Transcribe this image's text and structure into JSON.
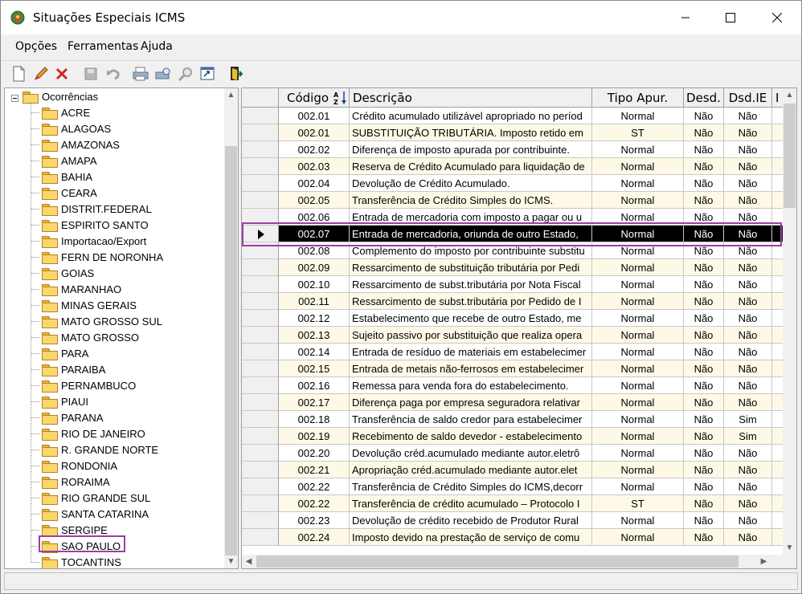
{
  "window": {
    "title": "Situações Especiais ICMS"
  },
  "menu": {
    "opcoes": "Opções",
    "ferramentas": "Ferramentas",
    "ajuda": "Ajuda"
  },
  "toolbar": {
    "icons": [
      "new-document-icon",
      "edit-pencil-icon",
      "delete-x-icon",
      "save-disk-icon",
      "undo-icon",
      "print-icon",
      "print-preview-icon",
      "search-icon",
      "export-icon",
      "exit-door-icon"
    ]
  },
  "tree": {
    "root": "Ocorrências",
    "items": [
      "ACRE",
      "ALAGOAS",
      "AMAZONAS",
      "AMAPA",
      "BAHIA",
      "CEARA",
      "DISTRIT.FEDERAL",
      "ESPIRITO SANTO",
      "Importacao/Export",
      "FERN DE NORONHA",
      "GOIAS",
      "MARANHAO",
      "MINAS GERAIS",
      "MATO GROSSO SUL",
      "MATO GROSSO",
      "PARA",
      "PARAIBA",
      "PERNAMBUCO",
      "PIAUI",
      "PARANA",
      "RIO DE JANEIRO",
      "R. GRANDE NORTE",
      "RONDONIA",
      "RORAIMA",
      "RIO GRANDE SUL",
      "SANTA CATARINA",
      "SERGIPE",
      "SAO PAULO",
      "TOCANTINS"
    ],
    "selected": "SAO PAULO"
  },
  "grid": {
    "headers": {
      "codigo": "Código",
      "sort_icon": "sort-az-icon",
      "descricao": "Descrição",
      "tipo": "Tipo Apur.",
      "desd": "Desd.",
      "dsdie": "Dsd.IE",
      "last": "I"
    },
    "rows": [
      [
        "002.01",
        "Crédito acumulado utilizável apropriado no períod",
        "Normal",
        "Não",
        "Não"
      ],
      [
        "002.01",
        "SUBSTITUIÇÃO TRIBUTÁRIA. Imposto retido em",
        "ST",
        "Não",
        "Não"
      ],
      [
        "002.02",
        "Diferença de imposto apurada por contribuinte.",
        "Normal",
        "Não",
        "Não"
      ],
      [
        "002.03",
        "Reserva de Crédito Acumulado para liquidação de",
        "Normal",
        "Não",
        "Não"
      ],
      [
        "002.04",
        "Devolução de Crédito Acumulado.",
        "Normal",
        "Não",
        "Não"
      ],
      [
        "002.05",
        "Transferência de Crédito Simples do ICMS.",
        "Normal",
        "Não",
        "Não"
      ],
      [
        "002.06",
        "Entrada de mercadoria com imposto a pagar ou u",
        "Normal",
        "Não",
        "Não"
      ],
      [
        "002.07",
        "Entrada de mercadoria, oriunda de outro Estado,",
        "Normal",
        "Não",
        "Não"
      ],
      [
        "002.08",
        "Complemento do imposto por contribuinte substitu",
        "Normal",
        "Não",
        "Não"
      ],
      [
        "002.09",
        "Ressarcimento de substituição tributária por Pedi",
        "Normal",
        "Não",
        "Não"
      ],
      [
        "002.10",
        "Ressarcimento de subst.tributária por Nota Fiscal",
        "Normal",
        "Não",
        "Não"
      ],
      [
        "002.11",
        "Ressarcimento de subst.tributária por Pedido de I",
        "Normal",
        "Não",
        "Não"
      ],
      [
        "002.12",
        "Estabelecimento que recebe de outro Estado, me",
        "Normal",
        "Não",
        "Não"
      ],
      [
        "002.13",
        "Sujeito passivo por substituição que realiza opera",
        "Normal",
        "Não",
        "Não"
      ],
      [
        "002.14",
        "Entrada de resíduo de materiais em estabelecimer",
        "Normal",
        "Não",
        "Não"
      ],
      [
        "002.15",
        "Entrada de metais não-ferrosos em estabelecimer",
        "Normal",
        "Não",
        "Não"
      ],
      [
        "002.16",
        "Remessa para venda fora do estabelecimento.",
        "Normal",
        "Não",
        "Não"
      ],
      [
        "002.17",
        "Diferença paga por empresa seguradora relativar",
        "Normal",
        "Não",
        "Não"
      ],
      [
        "002.18",
        "Transferência de saldo credor para estabelecimer",
        "Normal",
        "Não",
        "Sim"
      ],
      [
        "002.19",
        "Recebimento de saldo devedor - estabelecimento",
        "Normal",
        "Não",
        "Sim"
      ],
      [
        "002.20",
        "Devolução créd.acumulado mediante autor.eletrô",
        "Normal",
        "Não",
        "Não"
      ],
      [
        "002.21",
        "Apropriação créd.acumulado mediante autor.elet",
        "Normal",
        "Não",
        "Não"
      ],
      [
        "002.22",
        "Transferência de Crédito Simples do ICMS,decorr",
        "Normal",
        "Não",
        "Não"
      ],
      [
        "002.22",
        "Transferência de crédito acumulado – Protocolo I",
        "ST",
        "Não",
        "Não"
      ],
      [
        "002.23",
        "Devolução de crédito recebido de Produtor Rural",
        "Normal",
        "Não",
        "Não"
      ],
      [
        "002.24",
        "Imposto devido na prestação de serviço de comu",
        "Normal",
        "Não",
        "Não"
      ]
    ],
    "selected_index": 7
  },
  "colors": {
    "selected_row": "#000000",
    "alt_row": "#fdf9e6",
    "highlight": "#9b3fa3"
  }
}
